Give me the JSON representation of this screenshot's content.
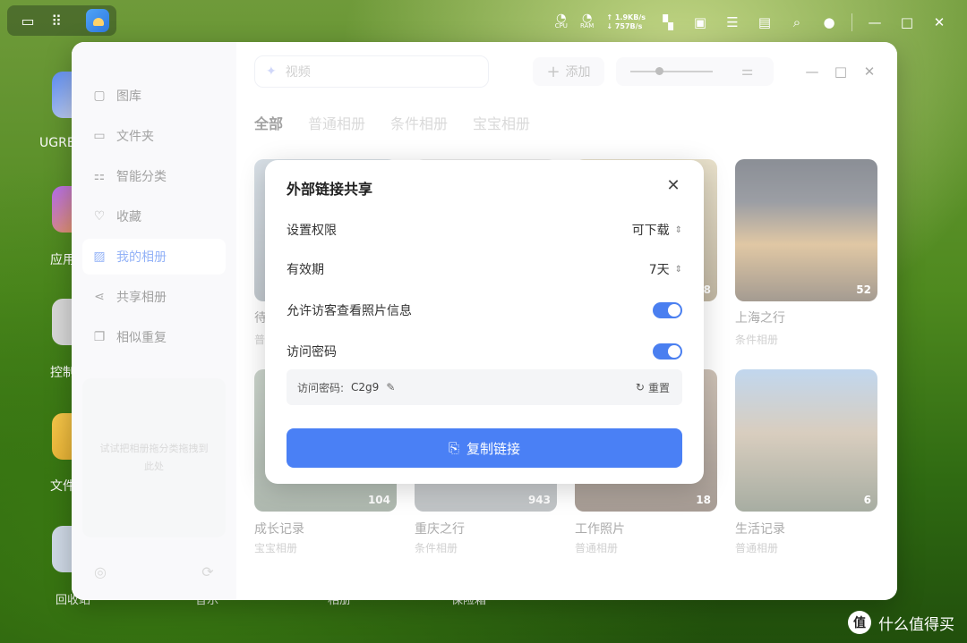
{
  "taskbar": {
    "cpu_label": "CPU",
    "ram_label": "RAM",
    "upload": "↑ 1.9KB/s",
    "download": "↓ 757B/s"
  },
  "desktop": {
    "apps": [
      "UGRE",
      "应用",
      "控制",
      "文件"
    ],
    "bottom": [
      "回收站",
      "音乐",
      "相册",
      "保险箱"
    ]
  },
  "window": {
    "search_placeholder": "视频",
    "add_label": "添加",
    "sidebar": [
      {
        "label": "图库",
        "icon": "image-icon"
      },
      {
        "label": "文件夹",
        "icon": "folder-icon"
      },
      {
        "label": "智能分类",
        "icon": "grid-icon"
      },
      {
        "label": "收藏",
        "icon": "heart-icon"
      },
      {
        "label": "我的相册",
        "icon": "album-icon"
      },
      {
        "label": "共享相册",
        "icon": "share-icon"
      },
      {
        "label": "相似重复",
        "icon": "duplicate-icon"
      }
    ],
    "drop_hint": "试试把相册拖分类拖拽到此处",
    "tabs": [
      "全部",
      "普通相册",
      "条件相册",
      "宝宝相册"
    ],
    "albums_row1": [
      {
        "title": "待",
        "sub": "普",
        "count": ""
      },
      {
        "title": "",
        "sub": "",
        "count": ""
      },
      {
        "title": "",
        "sub": "",
        "count": "8"
      },
      {
        "title": "上海之行",
        "sub": "条件相册",
        "count": "52"
      }
    ],
    "albums_row2": [
      {
        "title": "成长记录",
        "sub": "宝宝相册",
        "count": "104"
      },
      {
        "title": "重庆之行",
        "sub": "条件相册",
        "count": "943"
      },
      {
        "title": "工作照片",
        "sub": "普通相册",
        "count": "18"
      },
      {
        "title": "生活记录",
        "sub": "普通相册",
        "count": "6"
      }
    ]
  },
  "dialog": {
    "title": "外部链接共享",
    "permission_label": "设置权限",
    "permission_value": "可下载",
    "validity_label": "有效期",
    "validity_value": "7天",
    "allow_info_label": "允许访客查看照片信息",
    "password_label": "访问密码",
    "password_prefix": "访问密码:",
    "password_value": "C2g9",
    "reset_label": "重置",
    "copy_label": "复制链接"
  },
  "watermark": "什么值得买",
  "colors": {
    "accent": "#4a80f5"
  }
}
